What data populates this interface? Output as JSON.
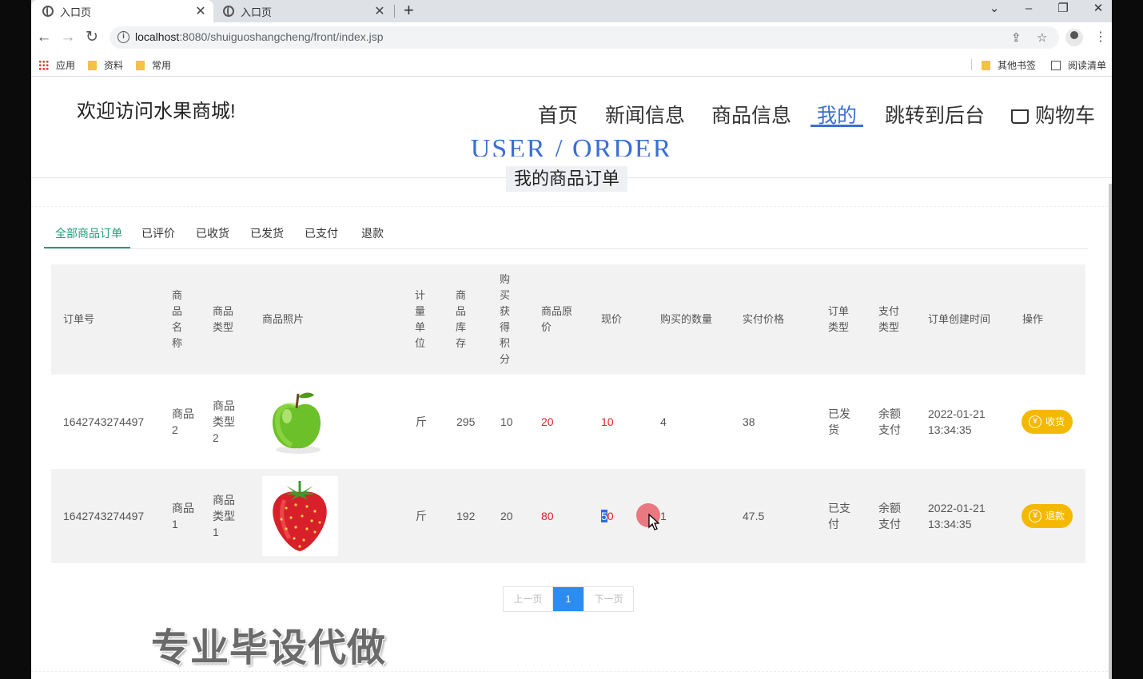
{
  "browser": {
    "tabs": [
      {
        "title": "入口页"
      },
      {
        "title": "入口页"
      }
    ],
    "new_tab_label": "+",
    "url_host": "localhost",
    "url_rest": ":8080/shuiguoshangcheng/front/index.jsp",
    "bookmarks": [
      "应用",
      "资料",
      "常用"
    ],
    "bookmarks_right": [
      "其他书签",
      "阅读清单"
    ]
  },
  "header": {
    "welcome": "欢迎访问水果商城!",
    "nav": [
      "首页",
      "新闻信息",
      "商品信息",
      "我的",
      "跳转到后台",
      "购物车"
    ],
    "active_nav": "我的"
  },
  "section": {
    "title_en": "USER / ORDER",
    "title_cn": "我的商品订单"
  },
  "filter_tabs": [
    "全部商品订单",
    "已评价",
    "已收货",
    "已发货",
    "已支付",
    "退款"
  ],
  "table": {
    "headers": [
      "订单号",
      "商品名称",
      "商品类型",
      "商品照片",
      "计量单位",
      "商品库存",
      "购买获得积分",
      "商品原价",
      "现价",
      "购买的数量",
      "实付价格",
      "订单类型",
      "支付类型",
      "订单创建时间",
      "操作"
    ],
    "rows": [
      {
        "order_no": "1642743274497",
        "name": "商品2",
        "type": "商品类型2",
        "photo": "apple",
        "unit": "斤",
        "stock": "295",
        "points": "10",
        "orig_price": "20",
        "price": "10",
        "qty": "4",
        "paid": "38",
        "order_type": "已发货",
        "pay_type": "余额支付",
        "created_date": "2022-01-21",
        "created_time": "13:34:35",
        "action": "收货"
      },
      {
        "order_no": "1642743274497",
        "name": "商品1",
        "type": "商品类型1",
        "photo": "strawberry",
        "unit": "斤",
        "stock": "192",
        "points": "20",
        "orig_price": "80",
        "price_sel": "5",
        "price_rest": "0",
        "qty": "1",
        "paid": "47.5",
        "order_type": "已支付",
        "pay_type": "余额支付",
        "created_date": "2022-01-21",
        "created_time": "13:34:35",
        "action": "退款"
      }
    ]
  },
  "pager": {
    "prev": "上一页",
    "current": "1",
    "next": "下一页"
  },
  "watermark": "专业毕设代做",
  "colors": {
    "accent": "#3b6fd4",
    "tab_active": "#1e9e78",
    "price_red": "#e02020",
    "button_yellow": "#f5b800",
    "pager_blue": "#2e8bf0"
  }
}
